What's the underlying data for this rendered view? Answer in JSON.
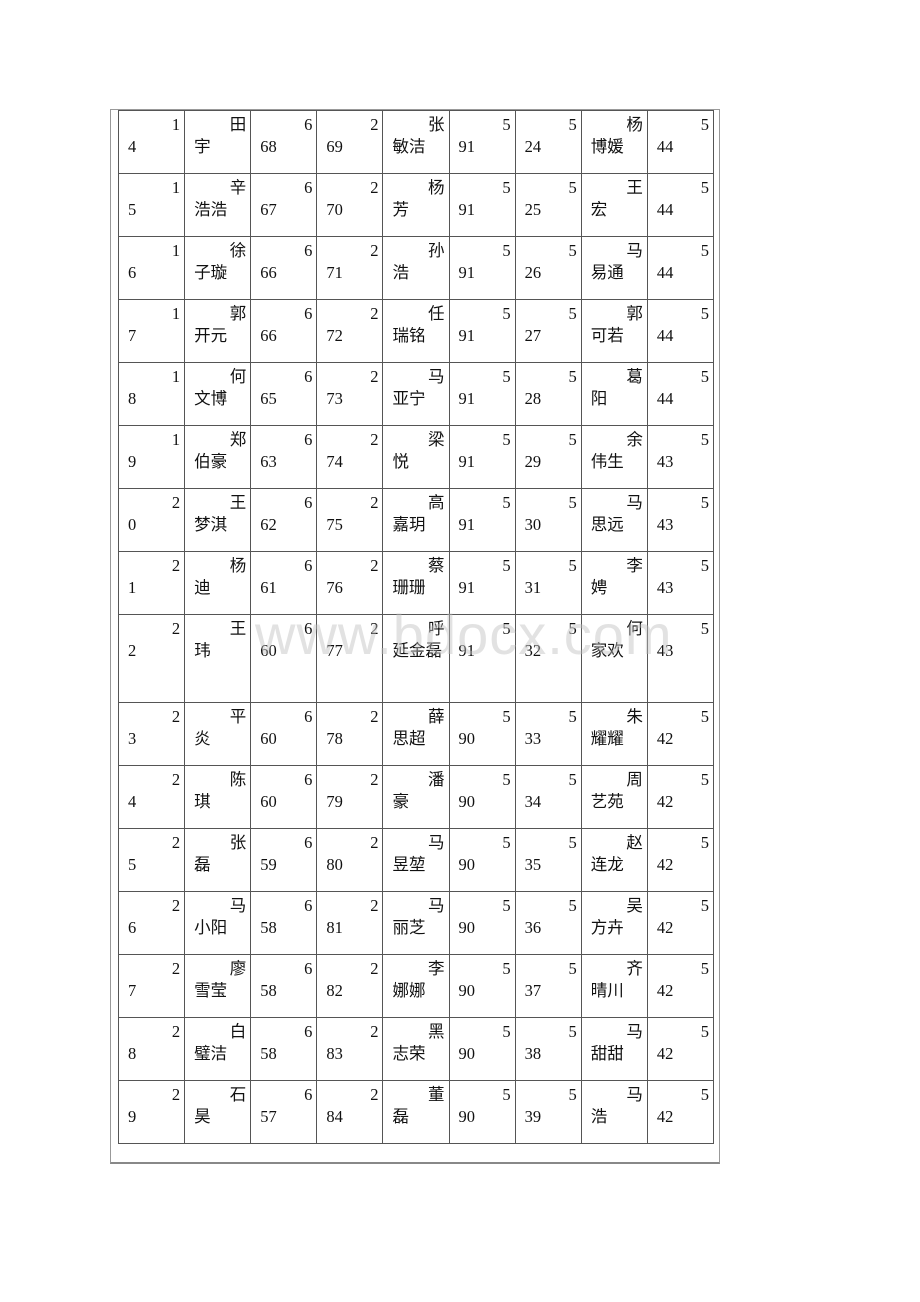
{
  "table": {
    "rows": [
      {
        "rank_a": [
          "1",
          "4"
        ],
        "name_a": [
          "田",
          "宇"
        ],
        "score_a": [
          "6",
          "68"
        ],
        "rank_b": [
          "2",
          "69"
        ],
        "name_b": [
          "张",
          "敏洁"
        ],
        "score_b": [
          "5",
          "91"
        ],
        "rank_c": [
          "5",
          "24"
        ],
        "name_c": [
          "杨",
          "博媛"
        ],
        "score_c": [
          "5",
          "44"
        ]
      },
      {
        "rank_a": [
          "1",
          "5"
        ],
        "name_a": [
          "辛",
          "浩浩"
        ],
        "score_a": [
          "6",
          "67"
        ],
        "rank_b": [
          "2",
          "70"
        ],
        "name_b": [
          "杨",
          "芳"
        ],
        "score_b": [
          "5",
          "91"
        ],
        "rank_c": [
          "5",
          "25"
        ],
        "name_c": [
          "王",
          "宏"
        ],
        "score_c": [
          "5",
          "44"
        ]
      },
      {
        "rank_a": [
          "1",
          "6"
        ],
        "name_a": [
          "徐",
          "子璇"
        ],
        "score_a": [
          "6",
          "66"
        ],
        "rank_b": [
          "2",
          "71"
        ],
        "name_b": [
          "孙",
          "浩"
        ],
        "score_b": [
          "5",
          "91"
        ],
        "rank_c": [
          "5",
          "26"
        ],
        "name_c": [
          "马",
          "易通"
        ],
        "score_c": [
          "5",
          "44"
        ]
      },
      {
        "rank_a": [
          "1",
          "7"
        ],
        "name_a": [
          "郭",
          "开元"
        ],
        "score_a": [
          "6",
          "66"
        ],
        "rank_b": [
          "2",
          "72"
        ],
        "name_b": [
          "任",
          "瑞铭"
        ],
        "score_b": [
          "5",
          "91"
        ],
        "rank_c": [
          "5",
          "27"
        ],
        "name_c": [
          "郭",
          "可若"
        ],
        "score_c": [
          "5",
          "44"
        ]
      },
      {
        "rank_a": [
          "1",
          "8"
        ],
        "name_a": [
          "何",
          "文博"
        ],
        "score_a": [
          "6",
          "65"
        ],
        "rank_b": [
          "2",
          "73"
        ],
        "name_b": [
          "马",
          "亚宁"
        ],
        "score_b": [
          "5",
          "91"
        ],
        "rank_c": [
          "5",
          "28"
        ],
        "name_c": [
          "葛",
          "阳"
        ],
        "score_c": [
          "5",
          "44"
        ]
      },
      {
        "rank_a": [
          "1",
          "9"
        ],
        "name_a": [
          "郑",
          "伯豪"
        ],
        "score_a": [
          "6",
          "63"
        ],
        "rank_b": [
          "2",
          "74"
        ],
        "name_b": [
          "梁",
          "悦"
        ],
        "score_b": [
          "5",
          "91"
        ],
        "rank_c": [
          "5",
          "29"
        ],
        "name_c": [
          "余",
          "伟生"
        ],
        "score_c": [
          "5",
          "43"
        ]
      },
      {
        "rank_a": [
          "2",
          "0"
        ],
        "name_a": [
          "王",
          "梦淇"
        ],
        "score_a": [
          "6",
          "62"
        ],
        "rank_b": [
          "2",
          "75"
        ],
        "name_b": [
          "高",
          "嘉玥"
        ],
        "score_b": [
          "5",
          "91"
        ],
        "rank_c": [
          "5",
          "30"
        ],
        "name_c": [
          "马",
          "思远"
        ],
        "score_c": [
          "5",
          "43"
        ]
      },
      {
        "rank_a": [
          "2",
          "1"
        ],
        "name_a": [
          "杨",
          "迪"
        ],
        "score_a": [
          "6",
          "61"
        ],
        "rank_b": [
          "2",
          "76"
        ],
        "name_b": [
          "蔡",
          "珊珊"
        ],
        "score_b": [
          "5",
          "91"
        ],
        "rank_c": [
          "5",
          "31"
        ],
        "name_c": [
          "李",
          "娉"
        ],
        "score_c": [
          "5",
          "43"
        ]
      },
      {
        "rank_a": [
          "2",
          "2"
        ],
        "name_a": [
          "王",
          "玮"
        ],
        "score_a": [
          "6",
          "60"
        ],
        "rank_b": [
          "2",
          "77"
        ],
        "name_b": [
          "呼",
          "延金磊"
        ],
        "score_b": [
          "5",
          "91"
        ],
        "rank_c": [
          "5",
          "32"
        ],
        "name_c": [
          "何",
          "家欢"
        ],
        "score_c": [
          "5",
          "43"
        ],
        "tall": true
      },
      {
        "rank_a": [
          "2",
          "3"
        ],
        "name_a": [
          "平",
          "炎"
        ],
        "score_a": [
          "6",
          "60"
        ],
        "rank_b": [
          "2",
          "78"
        ],
        "name_b": [
          "薛",
          "思超"
        ],
        "score_b": [
          "5",
          "90"
        ],
        "rank_c": [
          "5",
          "33"
        ],
        "name_c": [
          "朱",
          "耀耀"
        ],
        "score_c": [
          "5",
          "42"
        ]
      },
      {
        "rank_a": [
          "2",
          "4"
        ],
        "name_a": [
          "陈",
          "琪"
        ],
        "score_a": [
          "6",
          "60"
        ],
        "rank_b": [
          "2",
          "79"
        ],
        "name_b": [
          "潘",
          "豪"
        ],
        "score_b": [
          "5",
          "90"
        ],
        "rank_c": [
          "5",
          "34"
        ],
        "name_c": [
          "周",
          "艺苑"
        ],
        "score_c": [
          "5",
          "42"
        ]
      },
      {
        "rank_a": [
          "2",
          "5"
        ],
        "name_a": [
          "张",
          "磊"
        ],
        "score_a": [
          "6",
          "59"
        ],
        "rank_b": [
          "2",
          "80"
        ],
        "name_b": [
          "马",
          "昱堃"
        ],
        "score_b": [
          "5",
          "90"
        ],
        "rank_c": [
          "5",
          "35"
        ],
        "name_c": [
          "赵",
          "连龙"
        ],
        "score_c": [
          "5",
          "42"
        ]
      },
      {
        "rank_a": [
          "2",
          "6"
        ],
        "name_a": [
          "马",
          "小阳"
        ],
        "score_a": [
          "6",
          "58"
        ],
        "rank_b": [
          "2",
          "81"
        ],
        "name_b": [
          "马",
          "丽芝"
        ],
        "score_b": [
          "5",
          "90"
        ],
        "rank_c": [
          "5",
          "36"
        ],
        "name_c": [
          "吴",
          "方卉"
        ],
        "score_c": [
          "5",
          "42"
        ]
      },
      {
        "rank_a": [
          "2",
          "7"
        ],
        "name_a": [
          "廖",
          "雪莹"
        ],
        "score_a": [
          "6",
          "58"
        ],
        "rank_b": [
          "2",
          "82"
        ],
        "name_b": [
          "李",
          "娜娜"
        ],
        "score_b": [
          "5",
          "90"
        ],
        "rank_c": [
          "5",
          "37"
        ],
        "name_c": [
          "齐",
          "晴川"
        ],
        "score_c": [
          "5",
          "42"
        ]
      },
      {
        "rank_a": [
          "2",
          "8"
        ],
        "name_a": [
          "白",
          "璧洁"
        ],
        "score_a": [
          "6",
          "58"
        ],
        "rank_b": [
          "2",
          "83"
        ],
        "name_b": [
          "黑",
          "志荣"
        ],
        "score_b": [
          "5",
          "90"
        ],
        "rank_c": [
          "5",
          "38"
        ],
        "name_c": [
          "马",
          "甜甜"
        ],
        "score_c": [
          "5",
          "42"
        ]
      },
      {
        "rank_a": [
          "2",
          "9"
        ],
        "name_a": [
          "石",
          "昊"
        ],
        "score_a": [
          "6",
          "57"
        ],
        "rank_b": [
          "2",
          "84"
        ],
        "name_b": [
          "董",
          "磊"
        ],
        "score_b": [
          "5",
          "90"
        ],
        "rank_c": [
          "5",
          "39"
        ],
        "name_c": [
          "马",
          "浩"
        ],
        "score_c": [
          "5",
          "42"
        ]
      }
    ]
  },
  "watermark": "www.bdocx.com"
}
